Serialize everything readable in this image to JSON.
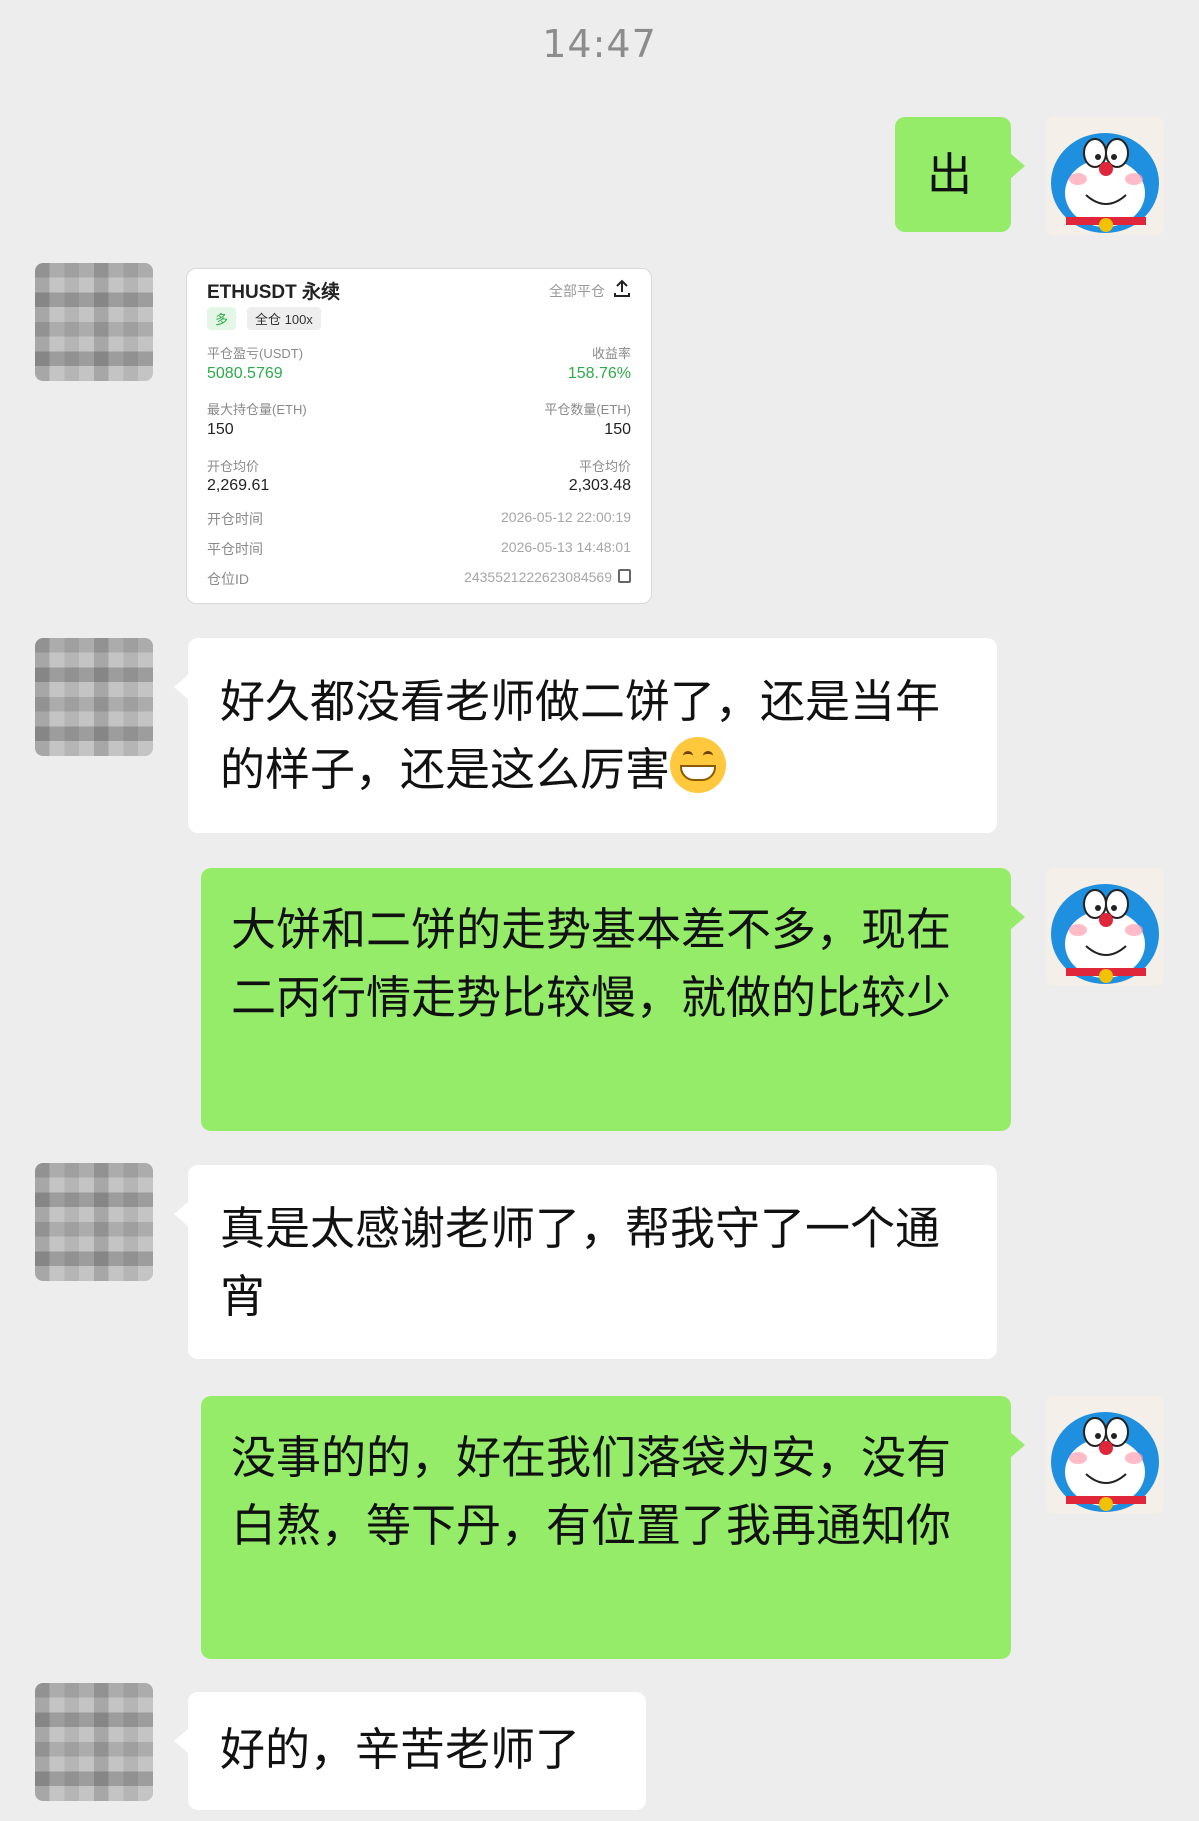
{
  "header": {
    "time": "14:47"
  },
  "messages": [
    {
      "side": "right",
      "text": "出"
    },
    {
      "side": "left",
      "type": "trade_card"
    },
    {
      "side": "left",
      "text": "好久都没看老师做二饼了，还是当年的样子，还是这么厉害",
      "emoji": "grinning-face-emoji"
    },
    {
      "side": "right",
      "text": "大饼和二饼的走势基本差不多，现在二丙行情走势比较慢，就做的比较少"
    },
    {
      "side": "left",
      "text": "真是太感谢老师了，帮我守了一个通宵"
    },
    {
      "side": "right",
      "text": "没事的的，好在我们落袋为安，没有白熬，等下丹，有位置了我再通知你"
    },
    {
      "side": "left",
      "text": "好的，辛苦老师了"
    }
  ],
  "trade_card": {
    "symbol": "ETHUSDT 永续",
    "close_all": "全部平仓",
    "direction": "多",
    "margin_mode": "全仓 100x",
    "pnl_label": "平仓盈亏(USDT)",
    "pnl_value": "5080.5769",
    "roi_label": "收益率",
    "roi_value": "158.76%",
    "max_pos_label": "最大持仓量(ETH)",
    "max_pos_value": "150",
    "close_qty_label": "平仓数量(ETH)",
    "close_qty_value": "150",
    "open_avg_label": "开仓均价",
    "open_avg_value": "2,269.61",
    "close_avg_label": "平仓均价",
    "close_avg_value": "2,303.48",
    "open_time_label": "开仓时间",
    "open_time_value": "2026-05-12 22:00:19",
    "close_time_label": "平仓时间",
    "close_time_value": "2026-05-13 14:48:01",
    "position_id_label": "仓位ID",
    "position_id_value": "2435521222623084569"
  },
  "colors": {
    "background": "#ededed",
    "self_bubble": "#95ec69",
    "other_bubble": "#ffffff",
    "profit_green": "#2eaa4b"
  }
}
